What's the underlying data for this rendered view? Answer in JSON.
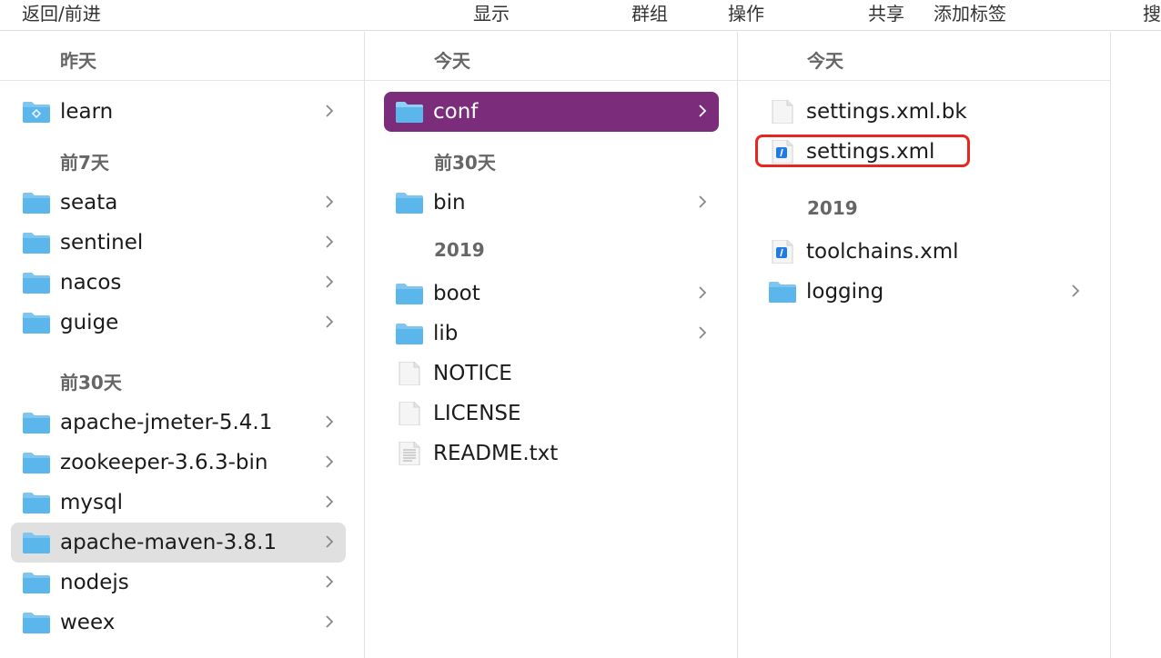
{
  "toolbar": {
    "back_forward": "返回/前进",
    "view": "显示",
    "group": "群组",
    "action": "操作",
    "share": "共享",
    "add_tag": "添加标签",
    "search": "搜"
  },
  "columns": [
    {
      "header": "昨天",
      "groups": [
        {
          "label": "",
          "items": [
            {
              "name": "learn",
              "kind": "folder-special"
            }
          ]
        },
        {
          "label": "前7天",
          "items": [
            {
              "name": "seata",
              "kind": "folder"
            },
            {
              "name": "sentinel",
              "kind": "folder"
            },
            {
              "name": "nacos",
              "kind": "folder"
            },
            {
              "name": "guige",
              "kind": "folder"
            }
          ]
        },
        {
          "label": "前30天",
          "items": [
            {
              "name": "apache-jmeter-5.4.1",
              "kind": "folder"
            },
            {
              "name": "zookeeper-3.6.3-bin",
              "kind": "folder"
            },
            {
              "name": "mysql",
              "kind": "folder"
            },
            {
              "name": "apache-maven-3.8.1",
              "kind": "folder"
            },
            {
              "name": "nodejs",
              "kind": "folder"
            },
            {
              "name": "weex",
              "kind": "folder"
            }
          ]
        }
      ]
    },
    {
      "header": "今天",
      "groups": [
        {
          "label": "",
          "items": [
            {
              "name": "conf",
              "kind": "folder"
            }
          ]
        },
        {
          "label": "前30天",
          "items": [
            {
              "name": "bin",
              "kind": "folder"
            }
          ]
        },
        {
          "label": "2019",
          "items": [
            {
              "name": "boot",
              "kind": "folder"
            },
            {
              "name": "lib",
              "kind": "folder"
            },
            {
              "name": "NOTICE",
              "kind": "file"
            },
            {
              "name": "LICENSE",
              "kind": "file"
            },
            {
              "name": "README.txt",
              "kind": "text"
            }
          ]
        }
      ]
    },
    {
      "header": "今天",
      "groups": [
        {
          "label": "",
          "items": [
            {
              "name": "settings.xml.bk",
              "kind": "file"
            },
            {
              "name": "settings.xml",
              "kind": "xml"
            }
          ]
        },
        {
          "label": "2019",
          "items": [
            {
              "name": "toolchains.xml",
              "kind": "xml"
            },
            {
              "name": "logging",
              "kind": "folder"
            }
          ]
        }
      ]
    }
  ],
  "colors": {
    "selected_row": "#7b2d7c",
    "inactive_selected_row": "#e0e0e0",
    "folder_blue": "#5bb6ec",
    "highlight_box": "#e8261f"
  }
}
